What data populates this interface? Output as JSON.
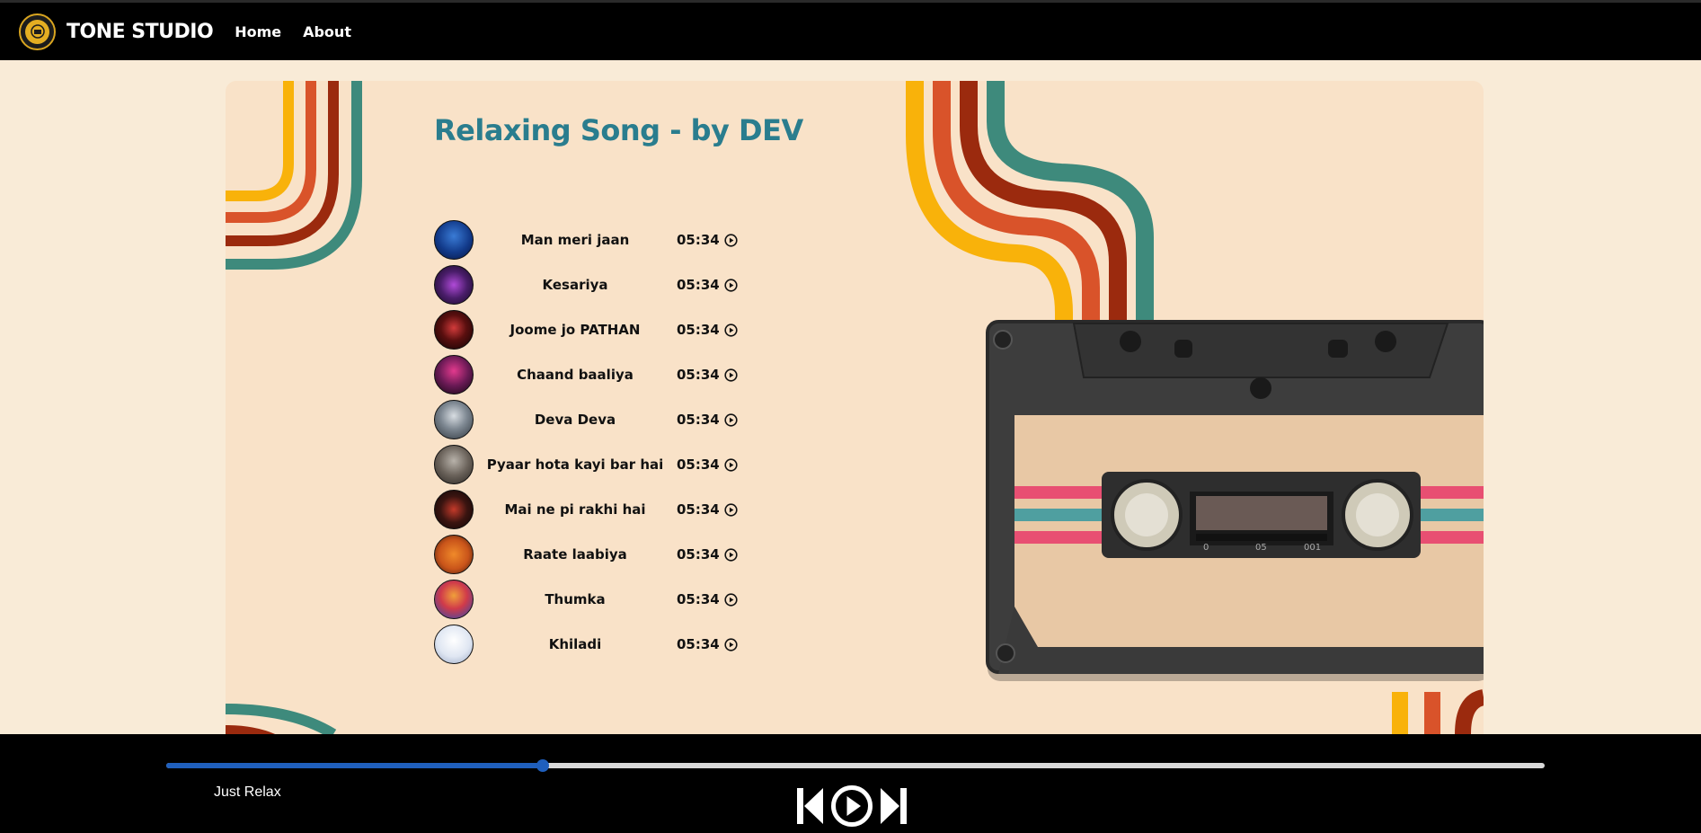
{
  "nav": {
    "brand": "TONE STUDIO",
    "links": [
      "Home",
      "About"
    ]
  },
  "playlist": {
    "title": "Relaxing Song - by DEV",
    "songs": [
      {
        "name": "Man meri jaan",
        "duration": "05:34"
      },
      {
        "name": "Kesariya",
        "duration": "05:34"
      },
      {
        "name": "Joome jo PATHAN",
        "duration": "05:34"
      },
      {
        "name": "Chaand baaliya",
        "duration": "05:34"
      },
      {
        "name": "Deva Deva",
        "duration": "05:34"
      },
      {
        "name": "Pyaar hota kayi bar hai",
        "duration": "05:34"
      },
      {
        "name": "Mai ne pi rakhi hai",
        "duration": "05:34"
      },
      {
        "name": "Raate laabiya",
        "duration": "05:34"
      },
      {
        "name": "Thumka",
        "duration": "05:34"
      },
      {
        "name": "Khiladi",
        "duration": "05:34"
      }
    ]
  },
  "cassette": {
    "counter_labels": [
      "0",
      "05",
      "001"
    ]
  },
  "player": {
    "now_playing": "Just Relax",
    "progress_percent": 27.3
  },
  "icons": {
    "play_small": "play-circle-icon",
    "previous": "previous-icon",
    "play": "play-icon",
    "next": "next-icon"
  },
  "colors": {
    "background": "#f9ebd7",
    "card": "#f9e2c8",
    "title": "#2a7d8e",
    "stripe_yellow": "#f9b20a",
    "stripe_orange": "#d9532a",
    "stripe_red": "#9b2a0e",
    "stripe_teal": "#3e8a7c",
    "progress": "#1f5fbd"
  }
}
